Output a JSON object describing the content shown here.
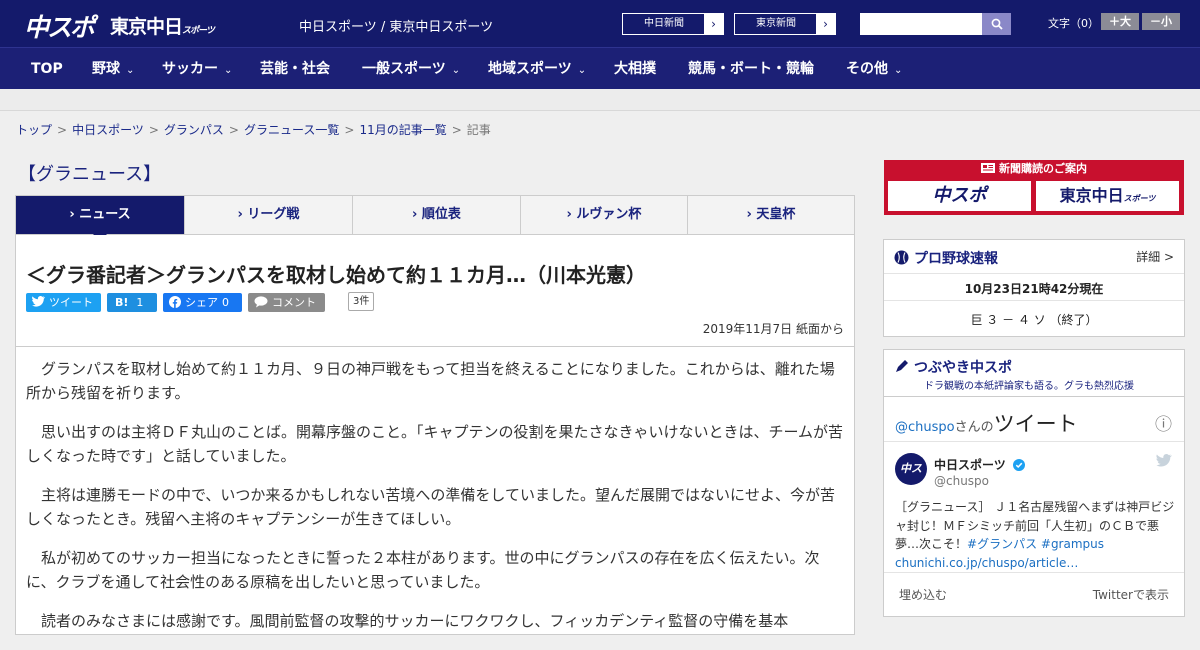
{
  "header": {
    "logo_chuspo": "中スポ",
    "logo_tokyo": "東京中日",
    "logo_tokyo_sub": "スポーツ",
    "site_title": "中日スポーツ / 東京中日スポーツ",
    "link_chunichi": "中日新聞",
    "link_tokyo": "東京新聞",
    "arrow": "›",
    "search_placeholder": "",
    "font_label": "文字（0）",
    "font_plus": "＋大",
    "font_minus": "－小"
  },
  "nav": {
    "items": [
      {
        "label": "TOP",
        "dropdown": false
      },
      {
        "label": "野球",
        "dropdown": true
      },
      {
        "label": "サッカー",
        "dropdown": true
      },
      {
        "label": "芸能・社会",
        "dropdown": false
      },
      {
        "label": "一般スポーツ",
        "dropdown": true
      },
      {
        "label": "地域スポーツ",
        "dropdown": true
      },
      {
        "label": "大相撲",
        "dropdown": false
      },
      {
        "label": "競馬・ボート・競輪",
        "dropdown": false
      },
      {
        "label": "その他",
        "dropdown": true
      }
    ],
    "chevron": "⌄"
  },
  "breadcrumb": {
    "links": [
      "トップ",
      "中日スポーツ",
      "グランパス",
      "グラニュース一覧",
      "11月の記事一覧"
    ],
    "current": "記事",
    "separator": ">"
  },
  "category_title": "【グラニュース】",
  "tabs": [
    {
      "label": "› ニュース",
      "active": true
    },
    {
      "label": "› リーグ戦",
      "active": false
    },
    {
      "label": "› 順位表",
      "active": false
    },
    {
      "label": "› ルヴァン杯",
      "active": false
    },
    {
      "label": "› 天皇杯",
      "active": false
    }
  ],
  "article": {
    "headline": "＜グラ番記者＞グランパスを取材し始めて約１１カ月…（川本光憲）",
    "share": {
      "tweet": "ツイート",
      "hatena_icon": "B!",
      "hatena_count": "1",
      "facebook": "シェア",
      "facebook_count": "0",
      "comment": "コメント",
      "comment_count": "3件"
    },
    "date": "2019年11月7日 紙面から",
    "paragraphs": [
      "グランパスを取材し始めて約１１カ月、９日の神戸戦をもって担当を終えることになりました。これからは、離れた場所から残留を祈ります。",
      "思い出すのは主将ＤＦ丸山のことば。開幕序盤のこと。「キャプテンの役割を果たさなきゃいけないときは、チームが苦しくなった時です」と話していました。",
      "主将は連勝モードの中で、いつか来るかもしれない苦境への準備をしていました。望んだ展開ではないにせよ、今が苦しくなったとき。残留へ主将のキャプテンシーが生きてほしい。",
      "私が初めてのサッカー担当になったときに誓った２本柱があります。世の中にグランパスの存在を広く伝えたい。次に、クラブを通して社会性のある原稿を出したいと思っていました。",
      "読者のみなさまには感謝です。風間前監督の攻撃的サッカーにワクワクし、フィッカデンティ監督の守備を基本"
    ]
  },
  "sidebar": {
    "ad": {
      "title": "新聞購読のご案内",
      "left": "中スポ",
      "right": "東京中日",
      "right_sub": "スポーツ"
    },
    "baseball": {
      "title": "プロ野球速報",
      "detail": "詳細 >",
      "updated": "10月23日21時42分現在",
      "score": "巨 ３ － ４ ソ （終了）"
    },
    "twitter": {
      "title": "つぶやき中スポ",
      "subtitle": "ドラ観戦の本紙評論家も語る。グラも熱烈応援",
      "by_handle": "@chuspo",
      "by_suffix": "さんの",
      "by_tweet": "ツイート",
      "info_icon": "ⓘ",
      "avatar_text": "中スポ",
      "name": "中日スポーツ",
      "handle": "@chuspo",
      "text": "［グラニュース］ Ｊ１名古屋残留へまずは神戸ビジャ封じ！ＭＦシミッチ前回「人生初」のＣＢで悪夢…次こそ！",
      "hashtags": "#グランパス #grampus",
      "link": "chunichi.co.jp/chuspo/article…",
      "embed": "埋め込む",
      "view": "Twitterで表示"
    }
  },
  "colors": {
    "navy": "#141a6b",
    "ad_red": "#c8102e",
    "twitter_blue": "#1da1f2",
    "facebook_blue": "#1877f2"
  }
}
